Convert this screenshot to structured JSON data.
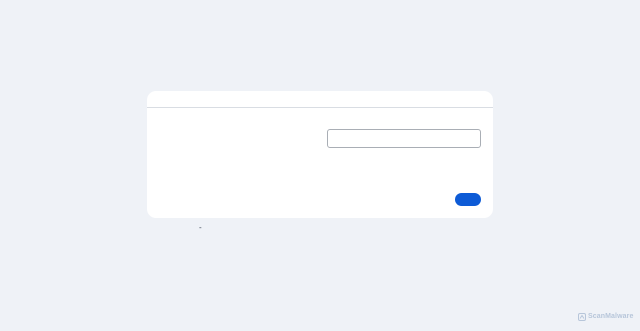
{
  "card": {
    "title": "",
    "field_label": "",
    "input": {
      "value": "",
      "placeholder": ""
    },
    "submit_label": ""
  },
  "footnote": "-",
  "watermark": {
    "text": "ScanMalware",
    "icon": "scanmalware-logo-icon"
  },
  "colors": {
    "page_background": "#eff2f7",
    "card_background": "#ffffff",
    "accent": "#0d5bd6",
    "watermark": "#b7c6da"
  }
}
